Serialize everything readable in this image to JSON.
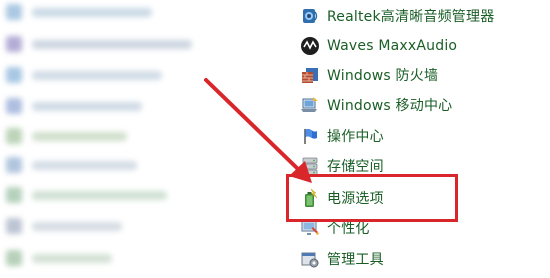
{
  "items": [
    {
      "label": "Realtek高清晰音频管理器",
      "icon": "speaker-icon"
    },
    {
      "label": "Waves MaxxAudio",
      "icon": "waves-icon"
    },
    {
      "label": "Windows 防火墙",
      "icon": "firewall-icon"
    },
    {
      "label": "Windows 移动中心",
      "icon": "mobility-center-icon"
    },
    {
      "label": "操作中心",
      "icon": "flag-icon"
    },
    {
      "label": "存储空间",
      "icon": "storage-icon"
    },
    {
      "label": "电源选项",
      "icon": "power-options-icon"
    },
    {
      "label": "个性化",
      "icon": "personalization-icon"
    },
    {
      "label": "管理工具",
      "icon": "admin-tools-icon"
    }
  ],
  "colors": {
    "link_text": "#1a5e26",
    "highlight": "#d8262a",
    "arrow": "#d8262a"
  }
}
